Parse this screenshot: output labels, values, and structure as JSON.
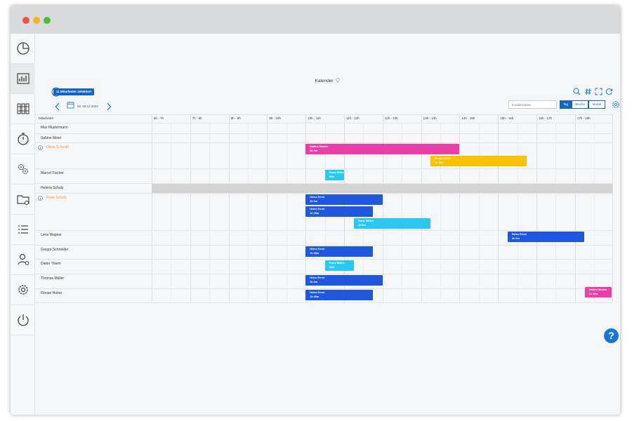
{
  "window": {
    "controls": {
      "close_color": "#ec5349",
      "minimize_color": "#f5b324",
      "maximize_color": "#52bc38"
    }
  },
  "sidebar": {
    "items": [
      {
        "icon": "pie-chart-icon"
      },
      {
        "icon": "bar-chart-icon",
        "active": true
      },
      {
        "icon": "binders-icon"
      },
      {
        "icon": "stopwatch-icon"
      },
      {
        "icon": "gears-icon"
      },
      {
        "icon": "folder-settings-icon"
      },
      {
        "icon": "list-icon"
      },
      {
        "icon": "user-settings-icon"
      },
      {
        "icon": "settings-icon"
      },
      {
        "icon": "power-icon"
      }
    ]
  },
  "calendar": {
    "title": "Kalender",
    "selected_badge": "11 Mitarbeiter selektiert",
    "date": "Mi, 08.12.2021",
    "customer_placeholder": "Kundenname",
    "view_tabs": [
      {
        "label": "Tag",
        "active": true
      },
      {
        "label": "Woche",
        "active": false
      },
      {
        "label": "Monat",
        "active": false
      }
    ],
    "column_header": "Mitarbeiter",
    "hours": [
      "6h - 7h",
      "7h - 8h",
      "8h - 9h",
      "9h - 10h",
      "10h - 11h",
      "11h - 12h",
      "12h - 13h",
      "13h - 14h",
      "14h - 15h",
      "15h - 16h",
      "16h - 17h",
      "17h - 18h"
    ],
    "employees": [
      {
        "name": "Max Mustermann",
        "warning": false,
        "events": []
      },
      {
        "name": "Sabine Meier",
        "warning": false,
        "events": []
      },
      {
        "name": "Olivia Schmidt",
        "warning": true,
        "events": [
          {
            "title": "Sabine Muster",
            "duration": "4h 0m",
            "start": 10,
            "end": 14,
            "color": "#e93fa7"
          },
          {
            "title": "Moritz Keller",
            "duration": "2h 30m",
            "start": 13.25,
            "end": 15.75,
            "color": "#fbc200"
          }
        ]
      },
      {
        "name": "Marcel Fischer",
        "warning": false,
        "events": [
          {
            "title": "Franz Müller",
            "duration": "30m",
            "start": 10.5,
            "end": 11,
            "color": "#29c7f3"
          }
        ]
      },
      {
        "name": "Helena Schulz",
        "warning": false,
        "unavailable": true,
        "events": []
      },
      {
        "name": "Peter Scholz",
        "warning": true,
        "events": [
          {
            "title": "Heinz Ernst",
            "duration": "2h 0m",
            "start": 10,
            "end": 12,
            "color": "#1f57de"
          },
          {
            "title": "Heinz Ernst",
            "duration": "1h 45m",
            "start": 10,
            "end": 11.75,
            "color": "#1f57de"
          },
          {
            "title": "Franz Müller",
            "duration": "2h 0m",
            "start": 11.25,
            "end": 13.25,
            "color": "#29c7f3"
          }
        ]
      },
      {
        "name": "Lena Wagner",
        "warning": false,
        "events": [
          {
            "title": "Heinz Ernst",
            "duration": "2h 0m",
            "start": 15.25,
            "end": 17.25,
            "color": "#1f57de"
          }
        ]
      },
      {
        "name": "Gregor Schneider",
        "warning": false,
        "events": [
          {
            "title": "Heinz Ernst",
            "duration": "1h 45m",
            "start": 10,
            "end": 11.75,
            "color": "#1f57de"
          }
        ]
      },
      {
        "name": "Dieter Thiem",
        "warning": false,
        "events": [
          {
            "title": "Franz Müller",
            "duration": "45m",
            "start": 10.5,
            "end": 11.25,
            "color": "#29c7f3"
          }
        ]
      },
      {
        "name": "Thomas Müller",
        "warning": false,
        "events": [
          {
            "title": "Heinz Ernst",
            "duration": "2h 0m",
            "start": 10,
            "end": 12,
            "color": "#1f57de"
          },
          {
            "title": "Sabine Muster",
            "duration": "1h 45m",
            "start": 17.25,
            "end": 19,
            "color": "#e93fa7"
          }
        ]
      },
      {
        "name": "Florian Huber",
        "warning": false,
        "events": [
          {
            "title": "Heinz Ernst",
            "duration": "1h 45m",
            "start": 10,
            "end": 11.75,
            "color": "#1f57de"
          }
        ]
      }
    ]
  },
  "help": {
    "label": "?"
  },
  "accent_color": "#1565c0",
  "warning_color": "#f29a38",
  "unavailable_color": "#d3d3d3"
}
